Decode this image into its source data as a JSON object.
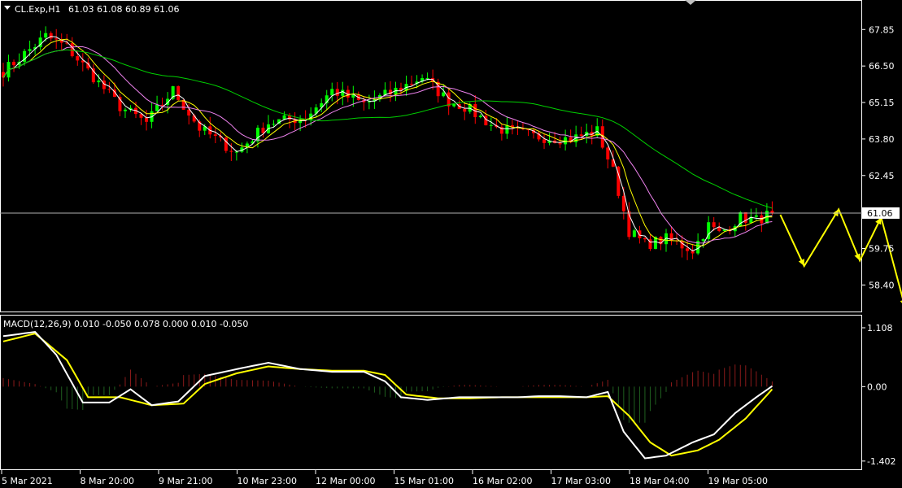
{
  "chart_data": {
    "type": "candlestick",
    "symbol_header": "CL.Exp,H1",
    "ohlc_header": "61.03 61.08 60.89 61.06",
    "indicator_header": "MACD(12,26,9) 0.010 -0.050 0.078 0.000 0.010 -0.050",
    "current_price_label": "61.06",
    "price_axis": {
      "ylim": [
        57.9,
        68.4
      ],
      "ticks": [
        "67.85",
        "66.50",
        "65.15",
        "63.80",
        "62.45",
        "59.75",
        "58.40"
      ],
      "current_price": 61.06
    },
    "macd_axis": {
      "ylim": [
        -1.45,
        1.2
      ],
      "ticks": [
        "1.108",
        "0.00",
        "-1.402"
      ]
    },
    "x_ticks": [
      "5 Mar 2021",
      "8 Mar 20:00",
      "9 Mar 21:00",
      "10 Mar 23:00",
      "12 Mar 00:00",
      "15 Mar 01:00",
      "16 Mar 02:00",
      "17 Mar 03:00",
      "18 Mar 04:00",
      "19 Mar 05:00"
    ],
    "price_path": [
      [
        0,
        66.3
      ],
      [
        8,
        67.6
      ],
      [
        12,
        67.2
      ],
      [
        22,
        65.0
      ],
      [
        27,
        64.4
      ],
      [
        32,
        65.6
      ],
      [
        37,
        64.2
      ],
      [
        44,
        63.3
      ],
      [
        50,
        64.4
      ],
      [
        57,
        64.6
      ],
      [
        62,
        65.6
      ],
      [
        68,
        65.1
      ],
      [
        73,
        65.5
      ],
      [
        79,
        66.1
      ],
      [
        84,
        65.2
      ],
      [
        87,
        65.0
      ],
      [
        93,
        64.2
      ],
      [
        100,
        63.9
      ],
      [
        107,
        63.8
      ],
      [
        112,
        64.1
      ],
      [
        115,
        62.6
      ],
      [
        118,
        60.4
      ],
      [
        121,
        59.9
      ],
      [
        125,
        60.1
      ],
      [
        130,
        59.7
      ],
      [
        133,
        60.6
      ],
      [
        135,
        60.3
      ],
      [
        139,
        60.9
      ],
      [
        142,
        60.8
      ],
      [
        145,
        61.06
      ]
    ],
    "macd_path": [
      [
        0,
        0.95
      ],
      [
        6,
        1.03
      ],
      [
        10,
        0.6
      ],
      [
        15,
        -0.3
      ],
      [
        20,
        -0.3
      ],
      [
        24,
        -0.05
      ],
      [
        28,
        -0.35
      ],
      [
        33,
        -0.28
      ],
      [
        38,
        0.2
      ],
      [
        45,
        0.35
      ],
      [
        50,
        0.45
      ],
      [
        56,
        0.33
      ],
      [
        62,
        0.28
      ],
      [
        68,
        0.28
      ],
      [
        72,
        0.1
      ],
      [
        75,
        -0.2
      ],
      [
        80,
        -0.25
      ],
      [
        86,
        -0.2
      ],
      [
        92,
        -0.2
      ],
      [
        97,
        -0.2
      ],
      [
        101,
        -0.18
      ],
      [
        105,
        -0.18
      ],
      [
        110,
        -0.2
      ],
      [
        114,
        -0.1
      ],
      [
        117,
        -0.85
      ],
      [
        121,
        -1.35
      ],
      [
        125,
        -1.3
      ],
      [
        130,
        -1.05
      ],
      [
        134,
        -0.9
      ],
      [
        138,
        -0.5
      ],
      [
        142,
        -0.2
      ],
      [
        145,
        0.01
      ]
    ],
    "signal_path": [
      [
        0,
        0.85
      ],
      [
        6,
        1.0
      ],
      [
        12,
        0.5
      ],
      [
        16,
        -0.2
      ],
      [
        22,
        -0.2
      ],
      [
        28,
        -0.35
      ],
      [
        34,
        -0.32
      ],
      [
        38,
        0.05
      ],
      [
        44,
        0.25
      ],
      [
        50,
        0.38
      ],
      [
        56,
        0.33
      ],
      [
        62,
        0.3
      ],
      [
        68,
        0.3
      ],
      [
        72,
        0.22
      ],
      [
        76,
        -0.15
      ],
      [
        82,
        -0.22
      ],
      [
        88,
        -0.22
      ],
      [
        94,
        -0.2
      ],
      [
        100,
        -0.2
      ],
      [
        106,
        -0.2
      ],
      [
        110,
        -0.2
      ],
      [
        114,
        -0.18
      ],
      [
        118,
        -0.55
      ],
      [
        122,
        -1.05
      ],
      [
        126,
        -1.3
      ],
      [
        131,
        -1.2
      ],
      [
        135,
        -1.0
      ],
      [
        140,
        -0.6
      ],
      [
        145,
        -0.05
      ]
    ],
    "projection_path": [
      [
        0,
        61.0
      ],
      [
        4.5,
        59.1
      ],
      [
        11,
        61.2
      ],
      [
        15,
        59.3
      ],
      [
        19,
        60.9
      ],
      [
        23.5,
        57.6
      ]
    ],
    "colors": {
      "bull": "#00ff00",
      "bear": "#ff0000",
      "ma_white": "#ffffff",
      "ma_yellow": "#ffff00",
      "ma_violet": "#ee82ee",
      "ma_green": "#00d000",
      "macd_line": "#ffffff",
      "signal_line": "#ffff00",
      "hist_pos": "#8b1a1a",
      "hist_neg": "#1f5f1f",
      "projection": "#ffff00",
      "grid_border": "#ffffff"
    }
  }
}
